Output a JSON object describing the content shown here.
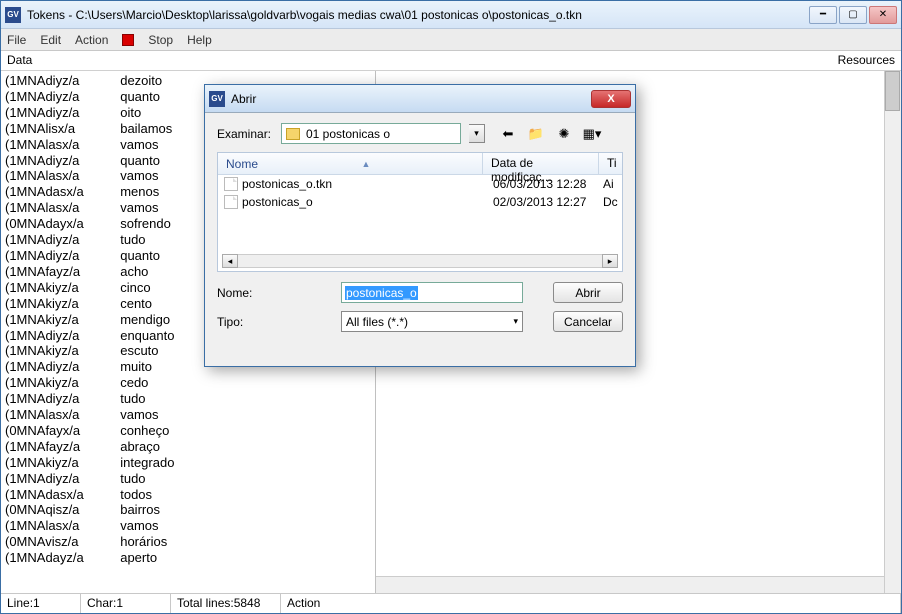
{
  "window": {
    "title": "Tokens - C:\\Users\\Marcio\\Desktop\\larissa\\goldvarb\\vogais medias cwa\\01 postonicas o\\postonicas_o.tkn",
    "app_icon": "GV"
  },
  "menubar": {
    "file": "File",
    "edit": "Edit",
    "action": "Action",
    "stop": "Stop",
    "help": "Help"
  },
  "headerbar": {
    "data": "Data",
    "resources": "Resources"
  },
  "data_rows": [
    {
      "c1": "(1MNAdiyz/a",
      "c2": "dezoito"
    },
    {
      "c1": "(1MNAdiyz/a",
      "c2": "quanto"
    },
    {
      "c1": "(1MNAdiyz/a",
      "c2": "oito"
    },
    {
      "c1": "(1MNAlisx/a",
      "c2": "bailamos"
    },
    {
      "c1": "(1MNAlasx/a",
      "c2": "vamos"
    },
    {
      "c1": "(1MNAdiyz/a",
      "c2": "quanto"
    },
    {
      "c1": "(1MNAlasx/a",
      "c2": "vamos"
    },
    {
      "c1": "(1MNAdasx/a",
      "c2": "menos"
    },
    {
      "c1": "(1MNAlasx/a",
      "c2": "vamos"
    },
    {
      "c1": "(0MNAdayx/a",
      "c2": "sofrendo"
    },
    {
      "c1": "(1MNAdiyz/a",
      "c2": "tudo"
    },
    {
      "c1": "(1MNAdiyz/a",
      "c2": "quanto"
    },
    {
      "c1": "(1MNAfayz/a",
      "c2": "acho"
    },
    {
      "c1": "(1MNAkiyz/a",
      "c2": "cinco"
    },
    {
      "c1": "(1MNAkiyz/a",
      "c2": "cento"
    },
    {
      "c1": "(1MNAkiyz/a",
      "c2": "mendigo"
    },
    {
      "c1": "(1MNAdiyz/a",
      "c2": "enquanto"
    },
    {
      "c1": "(1MNAkiyz/a",
      "c2": "escuto"
    },
    {
      "c1": "(1MNAdiyz/a",
      "c2": "muito"
    },
    {
      "c1": "(1MNAkiyz/a",
      "c2": "cedo"
    },
    {
      "c1": "(1MNAdiyz/a",
      "c2": "tudo"
    },
    {
      "c1": "(1MNAlasx/a",
      "c2": "vamos"
    },
    {
      "c1": "(0MNAfayx/a",
      "c2": "conheço"
    },
    {
      "c1": "(1MNAfayz/a",
      "c2": "abraço"
    },
    {
      "c1": "(1MNAkiyz/a",
      "c2": "integrado"
    },
    {
      "c1": "(1MNAdiyz/a",
      "c2": "tudo"
    },
    {
      "c1": "(1MNAdasx/a",
      "c2": "todos"
    },
    {
      "c1": "(0MNAqisz/a",
      "c2": "bairros"
    },
    {
      "c1": "(1MNAlasx/a",
      "c2": "vamos"
    },
    {
      "c1": "(0MNAvisz/a",
      "c2": "horários"
    },
    {
      "c1": "(1MNAdayz/a",
      "c2": "aperto"
    }
  ],
  "statusbar": {
    "line": "Line:1",
    "char": "Char:1",
    "total": "Total lines:5848",
    "action": "Action"
  },
  "dialog": {
    "title": "Abrir",
    "app_icon": "GV",
    "examine_label": "Examinar:",
    "folder": "01 postonicas o",
    "columns": {
      "name": "Nome",
      "date": "Data de modificaç...",
      "type": "Ti"
    },
    "files": [
      {
        "name": "postonicas_o.tkn",
        "date": "06/03/2013 12:28",
        "type": "Ai"
      },
      {
        "name": "postonicas_o",
        "date": "02/03/2013 12:27",
        "type": "Dc"
      }
    ],
    "name_label": "Nome:",
    "name_value": "postonicas_o",
    "type_label": "Tipo:",
    "type_value": "All files (*.*)",
    "open_btn": "Abrir",
    "cancel_btn": "Cancelar"
  }
}
